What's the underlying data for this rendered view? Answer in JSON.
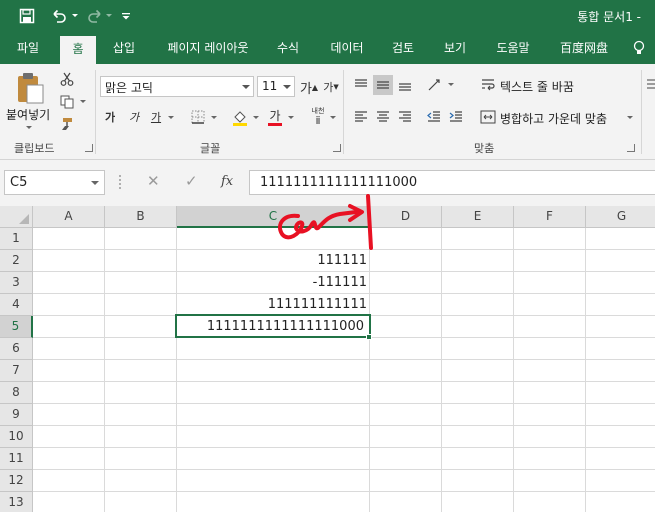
{
  "window": {
    "title": "통합 문서1 -"
  },
  "quick_access": {
    "save_icon": "save-icon",
    "undo_icon": "undo-icon",
    "redo_icon": "redo-icon",
    "customize_icon": "customize-quick-access-icon"
  },
  "ribbon_tabs": [
    {
      "label": "파일",
      "active": false
    },
    {
      "label": "홈",
      "active": true
    },
    {
      "label": "삽입",
      "active": false
    },
    {
      "label": "페이지 레이아웃",
      "active": false
    },
    {
      "label": "수식",
      "active": false
    },
    {
      "label": "데이터",
      "active": false
    },
    {
      "label": "검토",
      "active": false
    },
    {
      "label": "보기",
      "active": false
    },
    {
      "label": "도움말",
      "active": false
    },
    {
      "label": "百度网盘",
      "active": false
    }
  ],
  "tell_me_icon": "lightbulb-icon",
  "ribbon": {
    "clipboard": {
      "paste_label": "붙여넣기",
      "group_label": "클립보드"
    },
    "font": {
      "font_name": "맑은 고딕",
      "font_size": "11",
      "grow_label": "가",
      "shrink_label": "가",
      "bold_label": "가",
      "italic_label": "가",
      "underline_label": "가",
      "font_color_label": "가",
      "phonetic_label": "내천",
      "group_label": "글꼴",
      "font_color": "#e81123",
      "fill_color": "#ffd800"
    },
    "alignment": {
      "wrap_text_label": "텍스트 줄 바꿈",
      "merge_center_label": "병합하고 가운데 맞춤",
      "group_label": "맞춤"
    }
  },
  "formula_bar": {
    "name_box": "C5",
    "cancel_symbol": "✕",
    "enter_symbol": "✓",
    "fx_label": "fx",
    "formula": "1111111111111111000"
  },
  "sheet": {
    "columns": [
      "A",
      "B",
      "C",
      "D",
      "E",
      "F",
      "G"
    ],
    "selected_column": "C",
    "rows": [
      "1",
      "2",
      "3",
      "4",
      "5",
      "6",
      "7",
      "8",
      "9",
      "10",
      "11",
      "12",
      "13"
    ],
    "selected_row": "5",
    "cells": {
      "C2": "111111",
      "C3": "-111111",
      "C4": "111111111111",
      "C5": "1111111111111111000"
    },
    "selected_cell": "C5"
  },
  "annotation": {
    "color": "#e81123"
  },
  "theme": {
    "accent": "#217346"
  }
}
